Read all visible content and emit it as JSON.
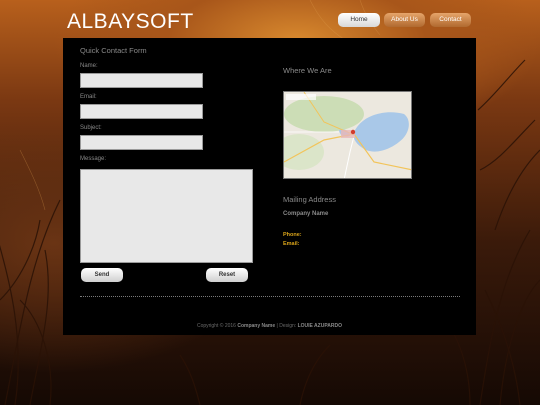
{
  "site": {
    "logo": "ALBAYSOFT"
  },
  "nav": {
    "items": [
      "Home",
      "About Us",
      "Contact"
    ]
  },
  "form": {
    "title": "Quick Contact Form",
    "name_label": "Name:",
    "email_label": "Email:",
    "subject_label": "Subject:",
    "message_label": "Message:",
    "send_label": "Send",
    "reset_label": "Reset"
  },
  "location": {
    "title": "Where We Are"
  },
  "mailing": {
    "title": "Mailing Address",
    "company": "Company Name",
    "phone_label": "Phone:",
    "email_label": "Email:"
  },
  "footer": {
    "copyright": "Copyright © 2016",
    "company": "Company Name",
    "design_prefix": "| Design:",
    "designer": "LOUIE AZUPARDO"
  },
  "colors": {
    "accent_gold": "#d9a31a",
    "panel_bg": "#000000",
    "muted_text": "#8a8a8a"
  }
}
